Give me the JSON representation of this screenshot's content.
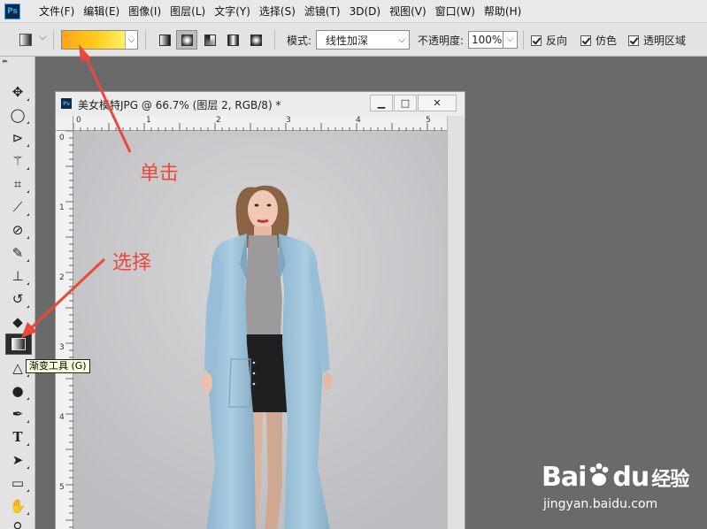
{
  "app": {
    "logo_text": "Ps"
  },
  "menu": [
    "文件(F)",
    "编辑(E)",
    "图像(I)",
    "图层(L)",
    "文字(Y)",
    "选择(S)",
    "滤镜(T)",
    "3D(D)",
    "视图(V)",
    "窗口(W)",
    "帮助(H)"
  ],
  "options_bar": {
    "mode_label": "模式:",
    "mode_value": "线性加深",
    "opacity_label": "不透明度:",
    "opacity_value": "100%",
    "checkboxes": [
      {
        "label": "反向",
        "checked": true
      },
      {
        "label": "仿色",
        "checked": true
      },
      {
        "label": "透明区域",
        "checked": true
      }
    ],
    "gradient_colors": [
      "#ffa31a",
      "#ffce1a",
      "#fff06a"
    ],
    "active_gradient_type": "radial"
  },
  "tooltip": "渐变工具 (G)",
  "document": {
    "title": "美女模特JPG @ 66.7% (图层 2, RGB/8) *",
    "window_buttons": {
      "minimize": "▁",
      "maximize": "□",
      "close": "✕"
    },
    "ruler_top": [
      "0",
      "1",
      "2",
      "3",
      "4",
      "5"
    ],
    "ruler_left": [
      "0",
      "1",
      "2",
      "3",
      "4",
      "5"
    ]
  },
  "annotations": {
    "click": "单击",
    "select": "选择"
  },
  "annotation_color": "#e8493a",
  "watermark": {
    "brand_a": "Bai",
    "brand_b": "du",
    "brand_c": "经验",
    "url": "jingyan.baidu.com"
  }
}
